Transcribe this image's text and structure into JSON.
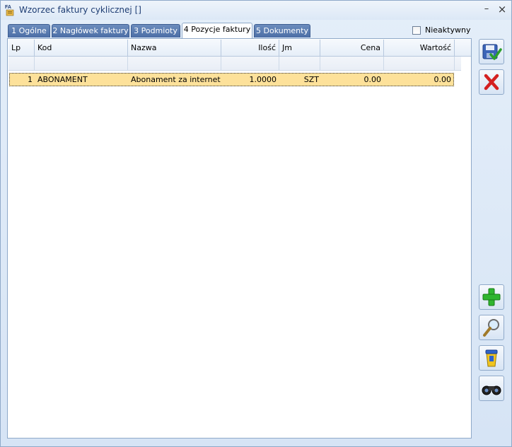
{
  "window": {
    "title": "Wzorzec faktury cyklicznej []",
    "app_icon": "fa-app-icon",
    "minimize_glyph": "–",
    "close_glyph": "×"
  },
  "tabs": [
    {
      "label": "1 Ogólne",
      "active": false
    },
    {
      "label": "2 Nagłówek faktury",
      "active": false
    },
    {
      "label": "3 Podmioty",
      "active": false
    },
    {
      "label": "4 Pozycje faktury",
      "active": true
    },
    {
      "label": "5 Dokumenty",
      "active": false
    }
  ],
  "inactive_checkbox": {
    "label": "Nieaktywny",
    "checked": false
  },
  "table": {
    "columns": [
      "Lp",
      "Kod",
      "Nazwa",
      "Ilość",
      "Jm",
      "Cena",
      "Wartość"
    ],
    "rows": [
      {
        "lp": "1",
        "kod": "ABONAMENT",
        "nazwa": "Abonament za internet",
        "ilosc": "1.0000",
        "jm": "SZT",
        "cena": "0.00",
        "wartosc": "0.00"
      }
    ]
  },
  "side_buttons": [
    {
      "name": "save-button",
      "icon": "save-check-icon"
    },
    {
      "name": "cancel-button",
      "icon": "red-x-icon"
    },
    {
      "name": "add-button",
      "icon": "green-plus-icon"
    },
    {
      "name": "view-button",
      "icon": "magnifier-icon"
    },
    {
      "name": "delete-button",
      "icon": "trash-bin-icon"
    },
    {
      "name": "search-button",
      "icon": "binoculars-icon"
    }
  ],
  "colors": {
    "selected_row": "#fde19a",
    "tab_inactive": "#4b6ea6",
    "window_bg": "#d9e6f5"
  }
}
